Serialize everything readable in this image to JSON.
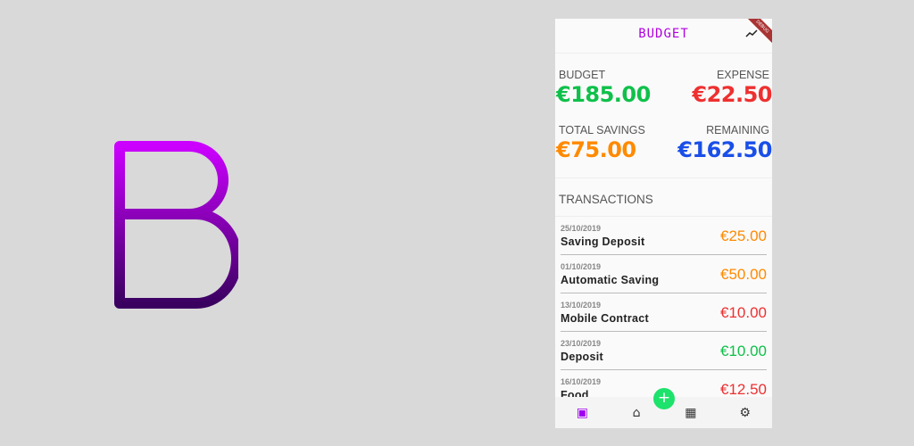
{
  "logo": {
    "name": "baht-logo-icon",
    "gradient": [
      "#cc00ff",
      "#3a0060"
    ]
  },
  "app": {
    "title": "BUDGET",
    "debug_banner": "DEBUG",
    "trend_icon": "trending-icon"
  },
  "summary": {
    "budget": {
      "label": "BUDGET",
      "value": "€185.00",
      "color": "#0fc04a"
    },
    "expense": {
      "label": "EXPENSE",
      "value": "€22.50",
      "color": "#ee3030"
    },
    "savings": {
      "label": "TOTAL SAVINGS",
      "value": "€75.00",
      "color": "#ff8a00"
    },
    "remaining": {
      "label": "REMAINING",
      "value": "€162.50",
      "color": "#1a4fe8"
    }
  },
  "transactions": {
    "title": "TRANSACTIONS",
    "items": [
      {
        "date": "25/10/2019",
        "name": "Saving Deposit",
        "amount": "€25.00",
        "color": "#ff8a00"
      },
      {
        "date": "01/10/2019",
        "name": "Automatic Saving",
        "amount": "€50.00",
        "color": "#ff8a00"
      },
      {
        "date": "13/10/2019",
        "name": "Mobile Contract",
        "amount": "€10.00",
        "color": "#ee3030"
      },
      {
        "date": "23/10/2019",
        "name": "Deposit",
        "amount": "€10.00",
        "color": "#0fc04a"
      },
      {
        "date": "16/10/2019",
        "name": "Food",
        "amount": "€12.50",
        "color": "#ee3030"
      }
    ]
  },
  "nav": {
    "items": [
      "wallet-icon",
      "home-icon",
      "calendar-icon",
      "settings-icon"
    ],
    "fab": "+"
  }
}
